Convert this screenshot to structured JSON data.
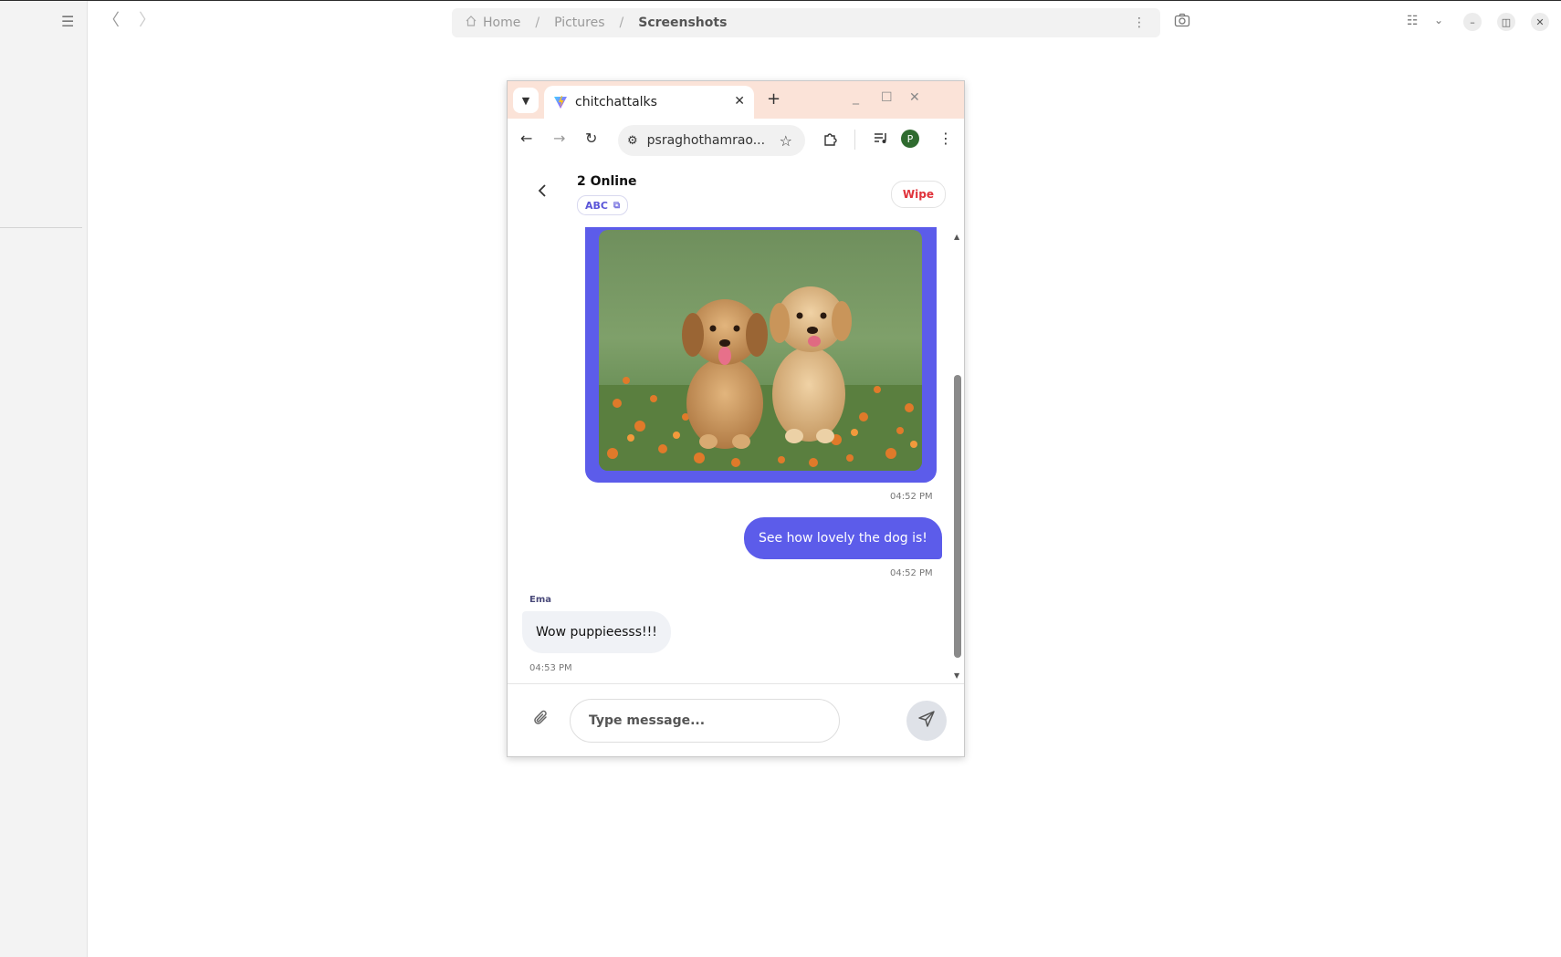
{
  "file_manager": {
    "breadcrumb": [
      "Home",
      "Pictures",
      "Screenshots"
    ],
    "icons": {
      "sidebar_toggle": "hamburger-icon",
      "back": "chevron-left-icon",
      "forward": "chevron-right-icon",
      "home": "home-icon",
      "path_menu": "kebab-menu-icon",
      "screenshot": "camera-icon",
      "view_list": "list-view-icon",
      "view_dropdown": "chevron-down-icon",
      "minimize": "minimize-icon",
      "restore": "restore-icon",
      "close": "close-icon"
    }
  },
  "browser": {
    "tab_title": "chitchattalks",
    "url": "psraghothamrao...",
    "profile_initial": "P",
    "icons": {
      "tab_search": "chevron-down-icon",
      "tab_close": "close-icon",
      "new_tab": "plus-icon",
      "back": "arrow-left-icon",
      "forward": "arrow-right-icon",
      "reload": "reload-icon",
      "site_info": "tune-icon",
      "bookmark": "star-icon",
      "extensions": "puzzle-icon",
      "media": "media-control-icon",
      "menu": "kebab-menu-icon"
    }
  },
  "chat": {
    "header": {
      "online_count": "2 Online",
      "room_code": "ABC",
      "wipe_label": "Wipe"
    },
    "messages": [
      {
        "type": "image",
        "direction": "outgoing",
        "time": "04:52 PM"
      },
      {
        "type": "text",
        "direction": "outgoing",
        "text": "See how lovely the dog is!",
        "time": "04:52 PM"
      },
      {
        "type": "text",
        "direction": "incoming",
        "sender": "Ema",
        "text": "Wow puppieesss!!!",
        "time": "04:53 PM"
      }
    ],
    "composer": {
      "placeholder": "Type message..."
    }
  },
  "colors": {
    "accent": "#5c5cea",
    "danger": "#e0323a",
    "tabbar": "#fbe3d8",
    "incoming_bubble": "#f0f2f6"
  }
}
